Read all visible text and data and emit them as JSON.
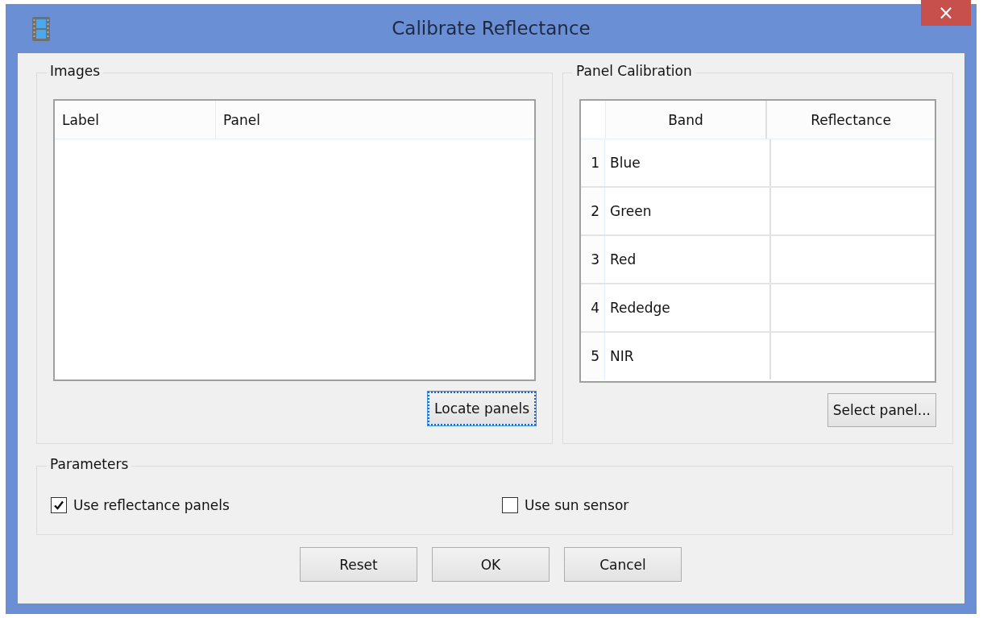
{
  "window": {
    "title": "Calibrate Reflectance",
    "close": "×"
  },
  "images": {
    "title": "Images",
    "columns": [
      "Label",
      "Panel"
    ],
    "button": {
      "label": "Locate panels",
      "focused": true
    }
  },
  "panel_calibration": {
    "title": "Panel Calibration",
    "columns": [
      "Band",
      "Reflectance"
    ],
    "rows": [
      {
        "index": "1",
        "band": "Blue"
      },
      {
        "index": "2",
        "band": "Green"
      },
      {
        "index": "3",
        "band": "Red"
      },
      {
        "index": "4",
        "band": "Rededge"
      },
      {
        "index": "5",
        "band": "NIR"
      }
    ],
    "button": {
      "label": "Select panel...",
      "focused": false
    }
  },
  "parameters": {
    "title": "Parameters",
    "options": [
      {
        "label": "Use reflectance panels",
        "checked": true
      },
      {
        "label": "Use sun sensor",
        "checked": false
      }
    ]
  },
  "buttons": [
    "Reset",
    "OK",
    "Cancel"
  ]
}
